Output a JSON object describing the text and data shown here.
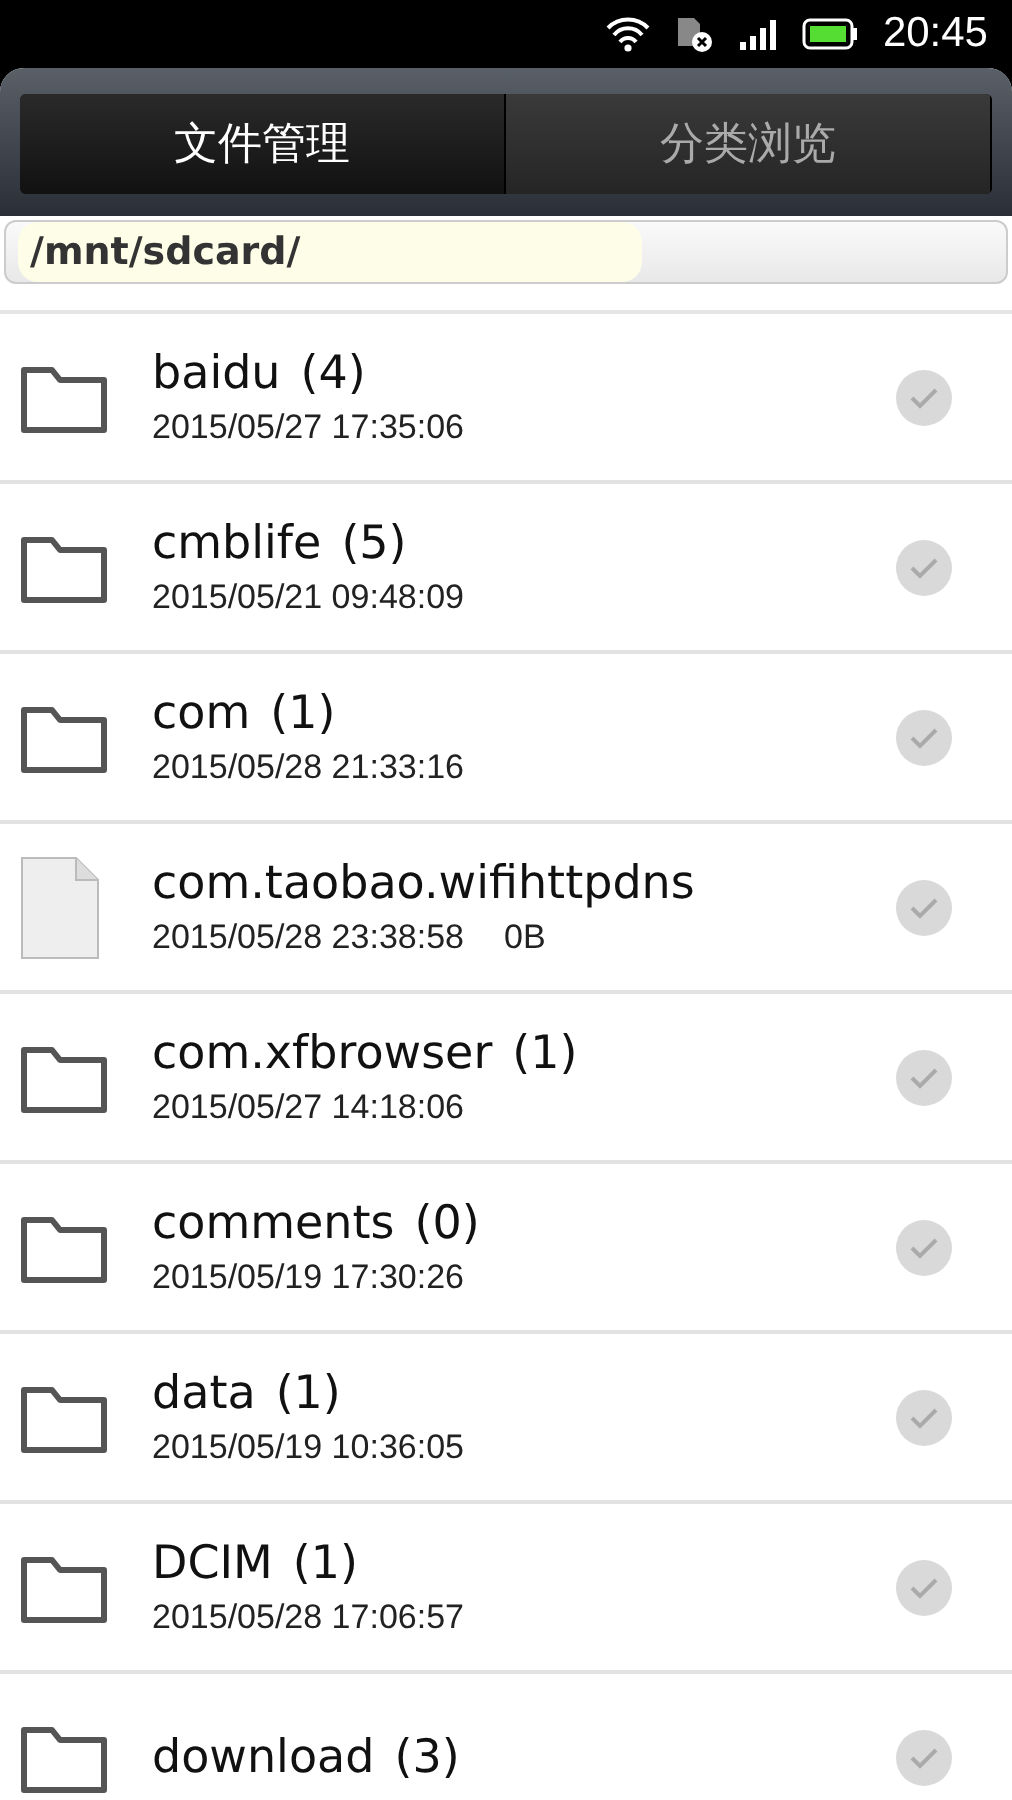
{
  "status_bar": {
    "time": "20:45"
  },
  "tabs": [
    {
      "label": "文件管理",
      "selected": true
    },
    {
      "label": "分类浏览",
      "selected": false
    }
  ],
  "path": "/mnt/sdcard/",
  "files": [
    {
      "kind": "folder",
      "name": "baidu",
      "count": "(4)",
      "date": "2015/05/27 17:35:06",
      "checked": false
    },
    {
      "kind": "folder",
      "name": "cmblife",
      "count": "(5)",
      "date": "2015/05/21 09:48:09",
      "checked": false
    },
    {
      "kind": "folder",
      "name": "com",
      "count": "(1)",
      "date": "2015/05/28 21:33:16",
      "checked": false
    },
    {
      "kind": "file",
      "name": "com.taobao.wifihttpdns",
      "date": "2015/05/28 23:38:58",
      "size": "0B",
      "checked": false
    },
    {
      "kind": "folder",
      "name": "com.xfbrowser",
      "count": "(1)",
      "date": "2015/05/27 14:18:06",
      "checked": false
    },
    {
      "kind": "folder",
      "name": "comments",
      "count": "(0)",
      "date": "2015/05/19 17:30:26",
      "checked": false
    },
    {
      "kind": "folder",
      "name": "data",
      "count": "(1)",
      "date": "2015/05/19 10:36:05",
      "checked": false
    },
    {
      "kind": "folder",
      "name": "DCIM",
      "count": "(1)",
      "date": "2015/05/28 17:06:57",
      "checked": false
    },
    {
      "kind": "folder",
      "name": "download",
      "count": "(3)",
      "checked": false
    }
  ]
}
